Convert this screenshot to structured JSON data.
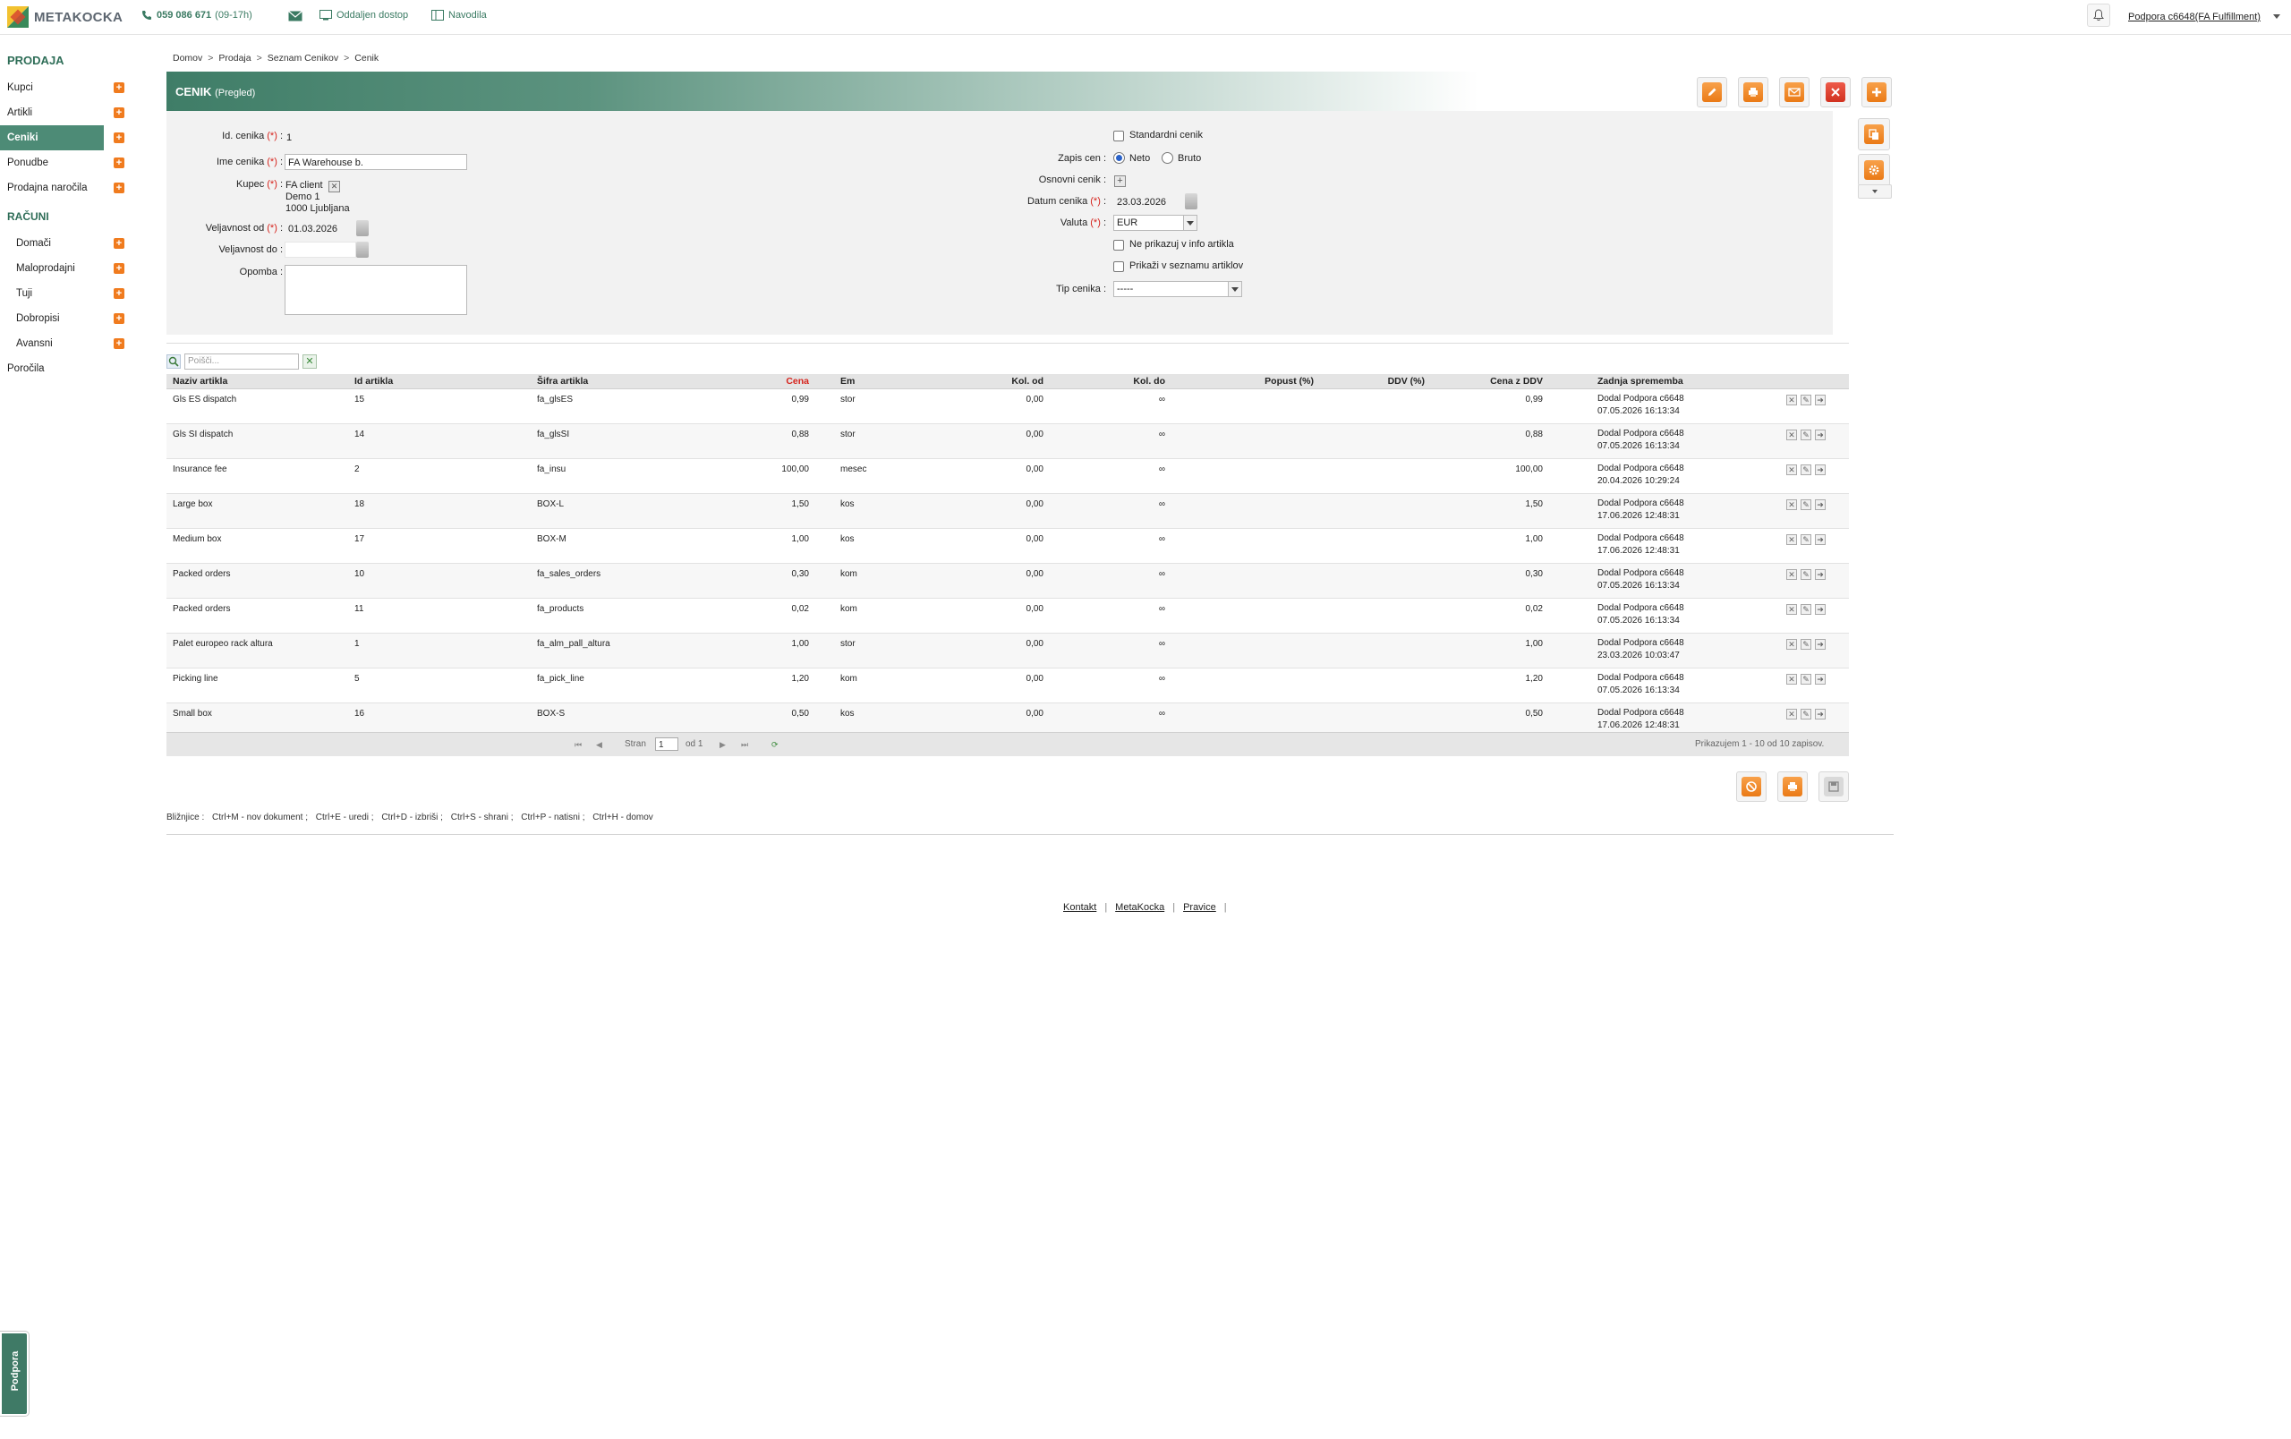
{
  "topbar": {
    "logo_text": "METAKOCKA",
    "phone": "059 086 671",
    "phone_hours": "(09-17h)",
    "remote_access": "Oddaljen dostop",
    "guides": "Navodila",
    "user": "Podpora c6648(FA Fulfillment)"
  },
  "sidebar": {
    "section_sales": "PRODAJA",
    "sales_items": [
      {
        "label": "Kupci"
      },
      {
        "label": "Artikli"
      },
      {
        "label": "Ceniki",
        "active": true
      },
      {
        "label": "Ponudbe"
      },
      {
        "label": "Prodajna naročila"
      }
    ],
    "section_invoices": "RAČUNI",
    "invoice_items": [
      {
        "label": "Domači"
      },
      {
        "label": "Maloprodajni"
      },
      {
        "label": "Tuji"
      },
      {
        "label": "Dobropisi"
      },
      {
        "label": "Avansni"
      }
    ],
    "reports": "Poročila"
  },
  "breadcrumb": [
    "Domov",
    "Prodaja",
    "Seznam Cenikov",
    "Cenik"
  ],
  "header": {
    "title": "CENIK",
    "subtitle": "(Pregled)"
  },
  "form": {
    "id_label": "Id. cenika",
    "id_value": "1",
    "name_label": "Ime cenika",
    "name_value": "FA Warehouse b.",
    "customer_label": "Kupec",
    "customer_name": "FA client",
    "customer_addr1": "Demo 1",
    "customer_addr2": "1000 Ljubljana",
    "valid_from_label": "Veljavnost od",
    "valid_from_value": "01.03.2026",
    "valid_to_label": "Veljavnost do",
    "note_label": "Opomba",
    "standard_label": "Standardni cenik",
    "price_entry_label": "Zapis cen",
    "neto_label": "Neto",
    "bruto_label": "Bruto",
    "base_label": "Osnovni cenik",
    "date_label": "Datum cenika",
    "date_value": "23.03.2026",
    "currency_label": "Valuta",
    "currency_value": "EUR",
    "hide_info_label": "Ne prikazuj v info artikla",
    "show_list_label": "Prikaži v seznamu artiklov",
    "type_label": "Tip cenika",
    "type_value": "-----",
    "req_mark": "(*)",
    "colon": ":"
  },
  "grid": {
    "search_placeholder": "Poišči...",
    "columns": {
      "name": "Naziv artikla",
      "id": "Id artikla",
      "code": "Šifra artikla",
      "price": "Cena",
      "unit": "Em",
      "qty_from": "Kol. od",
      "qty_to": "Kol. do",
      "discount": "Popust (%)",
      "vat": "DDV (%)",
      "price_vat": "Cena z DDV",
      "last_change": "Zadnja sprememba"
    },
    "rows": [
      {
        "name": "Gls ES dispatch",
        "id": "15",
        "code": "fa_glsES",
        "price": "0,99",
        "unit": "stor",
        "qty_from": "0,00",
        "qty_to": "∞",
        "price_vat": "0,99",
        "changed_by": "Dodal Podpora c6648",
        "changed_at": "07.05.2026 16:13:34"
      },
      {
        "name": "Gls SI dispatch",
        "id": "14",
        "code": "fa_glsSI",
        "price": "0,88",
        "unit": "stor",
        "qty_from": "0,00",
        "qty_to": "∞",
        "price_vat": "0,88",
        "changed_by": "Dodal Podpora c6648",
        "changed_at": "07.05.2026 16:13:34"
      },
      {
        "name": "Insurance fee",
        "id": "2",
        "code": "fa_insu",
        "price": "100,00",
        "unit": "mesec",
        "qty_from": "0,00",
        "qty_to": "∞",
        "price_vat": "100,00",
        "changed_by": "Dodal Podpora c6648",
        "changed_at": "20.04.2026 10:29:24"
      },
      {
        "name": "Large box",
        "id": "18",
        "code": "BOX-L",
        "price": "1,50",
        "unit": "kos",
        "qty_from": "0,00",
        "qty_to": "∞",
        "price_vat": "1,50",
        "changed_by": "Dodal Podpora c6648",
        "changed_at": "17.06.2026 12:48:31"
      },
      {
        "name": "Medium box",
        "id": "17",
        "code": "BOX-M",
        "price": "1,00",
        "unit": "kos",
        "qty_from": "0,00",
        "qty_to": "∞",
        "price_vat": "1,00",
        "changed_by": "Dodal Podpora c6648",
        "changed_at": "17.06.2026 12:48:31"
      },
      {
        "name": "Packed orders",
        "id": "10",
        "code": "fa_sales_orders",
        "price": "0,30",
        "unit": "kom",
        "qty_from": "0,00",
        "qty_to": "∞",
        "price_vat": "0,30",
        "changed_by": "Dodal Podpora c6648",
        "changed_at": "07.05.2026 16:13:34"
      },
      {
        "name": "Packed orders",
        "id": "11",
        "code": "fa_products",
        "price": "0,02",
        "unit": "kom",
        "qty_from": "0,00",
        "qty_to": "∞",
        "price_vat": "0,02",
        "changed_by": "Dodal Podpora c6648",
        "changed_at": "07.05.2026 16:13:34"
      },
      {
        "name": "Palet europeo rack altura",
        "id": "1",
        "code": "fa_alm_pall_altura",
        "price": "1,00",
        "unit": "stor",
        "qty_from": "0,00",
        "qty_to": "∞",
        "price_vat": "1,00",
        "changed_by": "Dodal Podpora c6648",
        "changed_at": "23.03.2026 10:03:47"
      },
      {
        "name": "Picking line",
        "id": "5",
        "code": "fa_pick_line",
        "price": "1,20",
        "unit": "kom",
        "qty_from": "0,00",
        "qty_to": "∞",
        "price_vat": "1,20",
        "changed_by": "Dodal Podpora c6648",
        "changed_at": "07.05.2026 16:13:34"
      },
      {
        "name": "Small box",
        "id": "16",
        "code": "BOX-S",
        "price": "0,50",
        "unit": "kos",
        "qty_from": "0,00",
        "qty_to": "∞",
        "price_vat": "0,50",
        "changed_by": "Dodal Podpora c6648",
        "changed_at": "17.06.2026 12:48:31"
      }
    ],
    "pager": {
      "page_label": "Stran",
      "page_value": "1",
      "of_label": "od 1",
      "summary": "Prikazujem 1 - 10 od 10 zapisov."
    }
  },
  "shortcuts": {
    "label": "Bližnjice :",
    "items": [
      "Ctrl+M - nov dokument ;",
      "Ctrl+E - uredi ;",
      "Ctrl+D - izbriši ;",
      "Ctrl+S - shrani ;",
      "Ctrl+P - natisni ;",
      "Ctrl+H - domov"
    ]
  },
  "footer": {
    "links": [
      "Kontakt",
      "MetaKocka",
      "Pravice"
    ],
    "sep": "|"
  },
  "support_tab": "Podpora",
  "colors": {
    "accent_green": "#4d8b76",
    "orange": "#f07b1e",
    "required_red": "#d6231c"
  }
}
